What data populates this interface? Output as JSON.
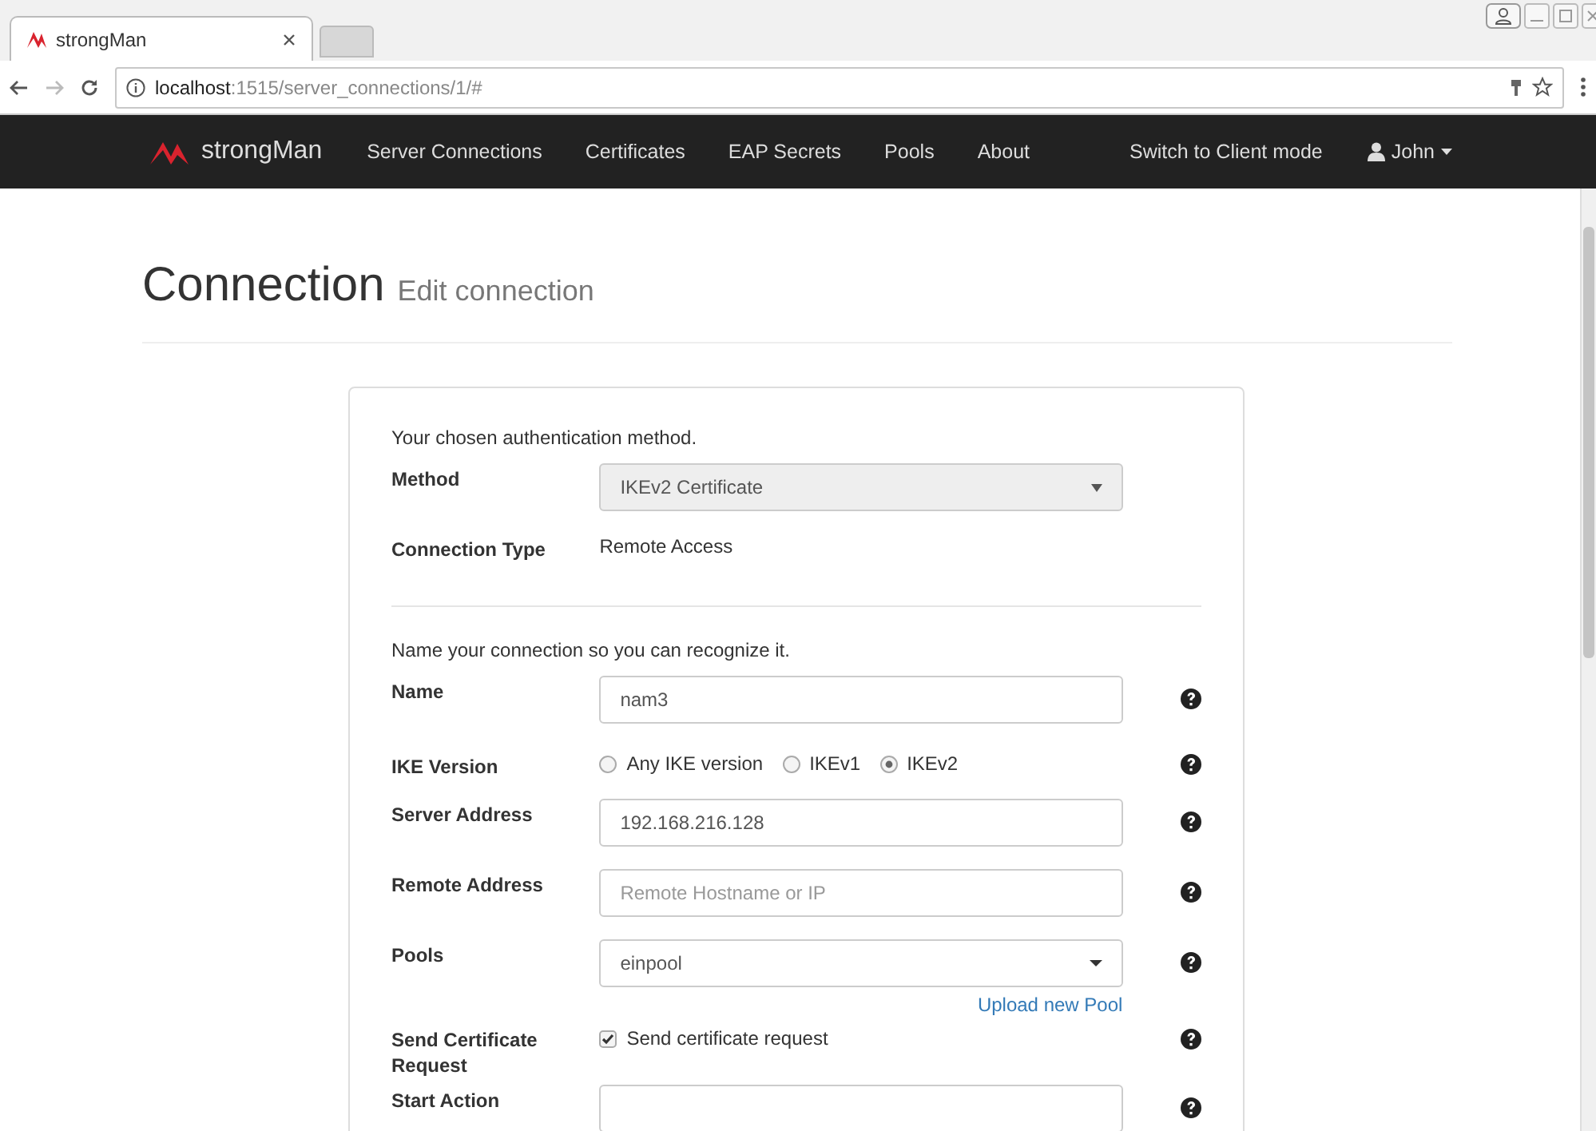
{
  "browser": {
    "tab": {
      "title": "strongMan",
      "selected": true
    },
    "url": {
      "host": "localhost",
      "path": ":1515/server_connections/1/#"
    }
  },
  "navbar": {
    "brand": "strongMan",
    "items": [
      "Server Connections",
      "Certificates",
      "EAP Secrets",
      "Pools",
      "About"
    ],
    "switch": "Switch to Client mode",
    "user": "John"
  },
  "header": {
    "title": "Connection",
    "subtitle": "Edit connection"
  },
  "sections": [
    {
      "intro": "Your chosen authentication method.",
      "fields": [
        {
          "kind": "select",
          "label": "Method",
          "value": "IKEv2 Certificate",
          "disabled": true,
          "help": false
        },
        {
          "kind": "static",
          "label": "Connection Type",
          "value": "Remote Access",
          "help": false
        }
      ]
    },
    {
      "intro": "Name your connection so you can recognize it.",
      "fields": [
        {
          "kind": "text",
          "label": "Name",
          "value": "nam3",
          "help": true
        },
        {
          "kind": "radio",
          "label": "IKE Version",
          "options": [
            {
              "label": "Any IKE version",
              "selected": false
            },
            {
              "label": "IKEv1",
              "selected": false
            },
            {
              "label": "IKEv2",
              "selected": true
            }
          ],
          "help": true
        },
        {
          "kind": "text",
          "label": "Server Address",
          "value": "192.168.216.128",
          "help": true
        },
        {
          "kind": "text",
          "label": "Remote Address",
          "placeholder": "Remote Hostname or IP",
          "help": true
        },
        {
          "kind": "dropdown",
          "label": "Pools",
          "value": "einpool",
          "link": "Upload new Pool",
          "help": true
        },
        {
          "kind": "checkbox",
          "label": "Send Certificate Request",
          "option": "Send certificate request",
          "checked": true,
          "help": true
        },
        {
          "kind": "text",
          "label": "Start Action",
          "help": true
        }
      ]
    }
  ]
}
